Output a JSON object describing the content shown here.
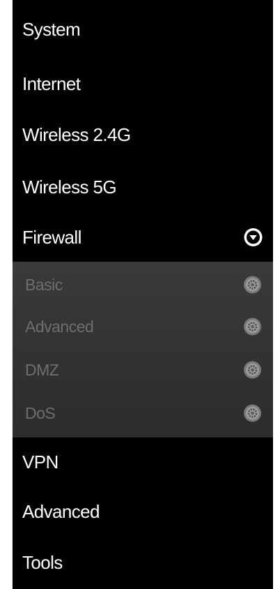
{
  "menu": {
    "items": [
      {
        "label": "System"
      },
      {
        "label": "Internet"
      },
      {
        "label": "Wireless 2.4G"
      },
      {
        "label": "Wireless 5G"
      },
      {
        "label": "Firewall",
        "expanded": true,
        "icon": "chevron-down-circle-icon"
      },
      {
        "label": "VPN"
      },
      {
        "label": "Advanced"
      },
      {
        "label": "Tools"
      }
    ],
    "firewall_submenu": [
      {
        "label": "Basic",
        "icon": "gear-icon"
      },
      {
        "label": "Advanced",
        "icon": "gear-icon"
      },
      {
        "label": "DMZ",
        "icon": "gear-icon"
      },
      {
        "label": "DoS",
        "icon": "gear-icon"
      }
    ]
  },
  "colors": {
    "menu_background": "#000000",
    "menu_text": "#ffffff",
    "submenu_background": "#333333",
    "submenu_text": "#6e6e6e"
  }
}
